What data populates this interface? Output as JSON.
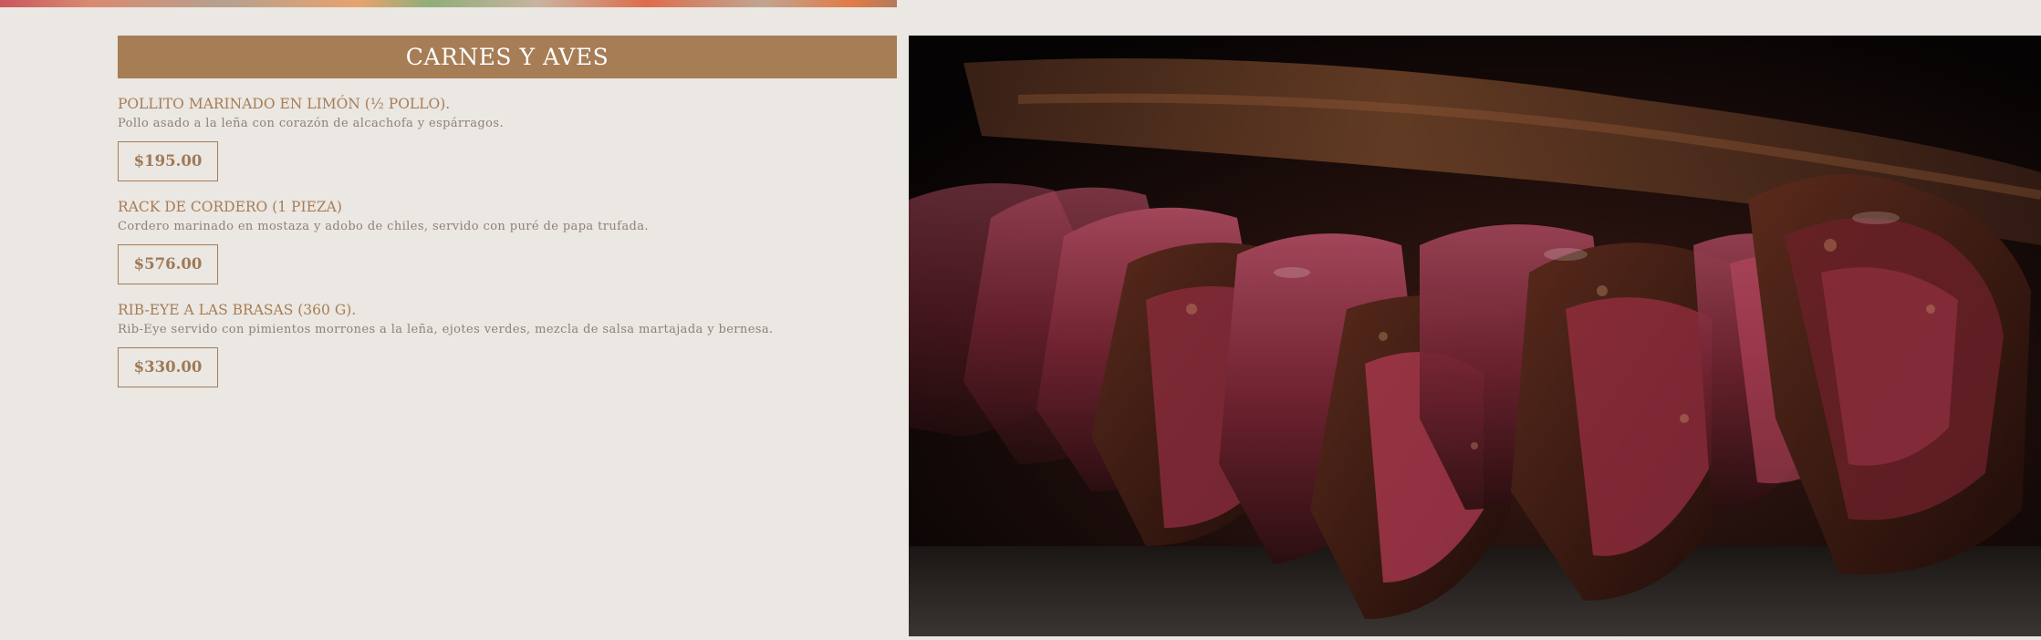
{
  "section": {
    "title": "CARNES Y AVES"
  },
  "items": [
    {
      "name": "POLLITO MARINADO EN LIMÓN (½ POLLO).",
      "description": "Pollo asado a la leña con corazón de alcachofa y espárragos.",
      "price": "$195.00"
    },
    {
      "name": "RACK DE CORDERO (1 PIEZA)",
      "description": "Cordero marinado en mostaza y adobo de chiles, servido con puré de papa trufada.",
      "price": "$576.00"
    },
    {
      "name": "RIB-EYE A LAS BRASAS (360 G).",
      "description": "Rib-Eye servido con pimientos morrones a la leña, ejotes verdes, mezcla de salsa martajada y bernesa.",
      "price": "$330.00"
    }
  ],
  "colors": {
    "background": "#ebe7e2",
    "accent": "#a67d55",
    "description_text": "#8f8079"
  }
}
